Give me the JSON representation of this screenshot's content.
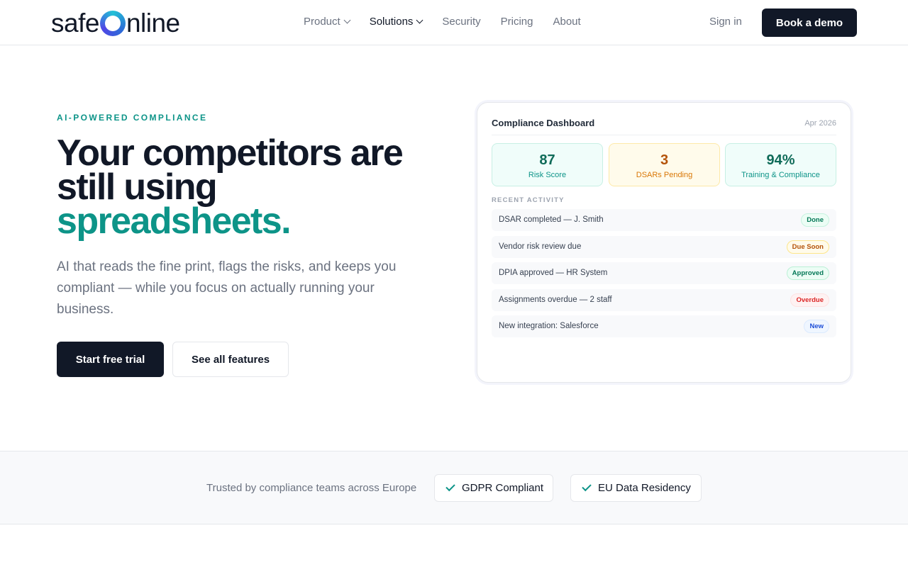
{
  "nav": {
    "logo_left": "safe",
    "logo_right": "nline",
    "links": [
      {
        "label": "Product"
      },
      {
        "label": "Solutions"
      },
      {
        "label": "Security"
      },
      {
        "label": "Pricing"
      },
      {
        "label": "About"
      }
    ],
    "sign_in": "Sign in",
    "cta": "Book a demo"
  },
  "hero": {
    "eyebrow": "AI-POWERED COMPLIANCE",
    "headline_line1": "Your competitors are",
    "headline_line2": "still using",
    "headline_accent": "spreadsheets.",
    "subtext": "AI that reads the fine print, flags the risks, and keeps you compliant — while you focus on actually running your business.",
    "primary_cta": "Start free trial",
    "secondary_cta": "See all features"
  },
  "dashboard": {
    "title": "Compliance Dashboard",
    "date": "Apr 2026",
    "stats": [
      {
        "value": "87",
        "label": "Risk Score"
      },
      {
        "value": "3",
        "label": "DSARs Pending"
      },
      {
        "value": "94%",
        "label": "Training & Compliance"
      }
    ],
    "section_label": "RECENT ACTIVITY",
    "activity": [
      {
        "text": "DSAR completed — J. Smith",
        "badge": "Done"
      },
      {
        "text": "Vendor risk review due",
        "badge": "Due Soon"
      },
      {
        "text": "DPIA approved — HR System",
        "badge": "Approved"
      },
      {
        "text": "Assignments overdue — 2 staff",
        "badge": "Overdue"
      },
      {
        "text": "New integration: Salesforce",
        "badge": "New"
      }
    ]
  },
  "trust": {
    "text": "Trusted by compliance teams across Europe",
    "badges": [
      {
        "label": "GDPR Compliant"
      },
      {
        "label": "EU Data Residency"
      }
    ]
  },
  "colors": {
    "accent": "#0d9488",
    "dark": "#111827",
    "muted": "#6b7280"
  }
}
